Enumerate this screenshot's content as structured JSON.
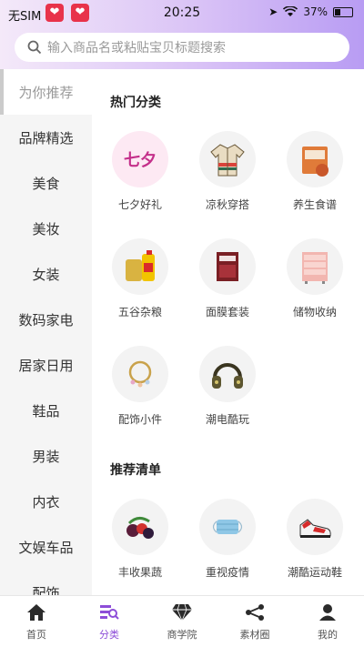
{
  "status": {
    "carrier": "无SIM",
    "time": "20:25",
    "battery": "37%"
  },
  "search": {
    "placeholder": "输入商品名或粘贴宝贝标题搜索"
  },
  "sidebar": {
    "items": [
      {
        "label": "为你推荐",
        "active": true
      },
      {
        "label": "品牌精选"
      },
      {
        "label": "美食"
      },
      {
        "label": "美妆"
      },
      {
        "label": "女装"
      },
      {
        "label": "数码家电"
      },
      {
        "label": "居家日用"
      },
      {
        "label": "鞋品"
      },
      {
        "label": "男装"
      },
      {
        "label": "内衣"
      },
      {
        "label": "文娱车品"
      },
      {
        "label": "配饰"
      }
    ]
  },
  "sections": {
    "hot": {
      "title": "热门分类",
      "items": [
        {
          "label": "七夕好礼",
          "icon": "qixi-gift-icon"
        },
        {
          "label": "凉秋穿搭",
          "icon": "jacket-icon"
        },
        {
          "label": "养生食谱",
          "icon": "health-food-icon"
        },
        {
          "label": "五谷杂粮",
          "icon": "grain-oil-icon"
        },
        {
          "label": "面膜套装",
          "icon": "face-mask-icon"
        },
        {
          "label": "储物收纳",
          "icon": "storage-drawer-icon"
        },
        {
          "label": "配饰小件",
          "icon": "bracelet-icon"
        },
        {
          "label": "潮电酷玩",
          "icon": "headphones-icon"
        }
      ]
    },
    "recommend": {
      "title": "推荐清单",
      "items": [
        {
          "label": "丰收果蔬",
          "icon": "fruit-icon"
        },
        {
          "label": "重视疫情",
          "icon": "medical-mask-icon"
        },
        {
          "label": "潮酷运动鞋",
          "icon": "sneaker-icon"
        }
      ]
    }
  },
  "tabbar": {
    "items": [
      {
        "label": "首页",
        "icon": "home-icon"
      },
      {
        "label": "分类",
        "icon": "category-icon",
        "active": true
      },
      {
        "label": "商学院",
        "icon": "diamond-icon"
      },
      {
        "label": "素材圈",
        "icon": "share-icon"
      },
      {
        "label": "我的",
        "icon": "user-icon"
      }
    ]
  },
  "colors": {
    "accent": "#8d4dd8",
    "header_start": "#f4e9f9",
    "header_end": "#b89cf3"
  }
}
